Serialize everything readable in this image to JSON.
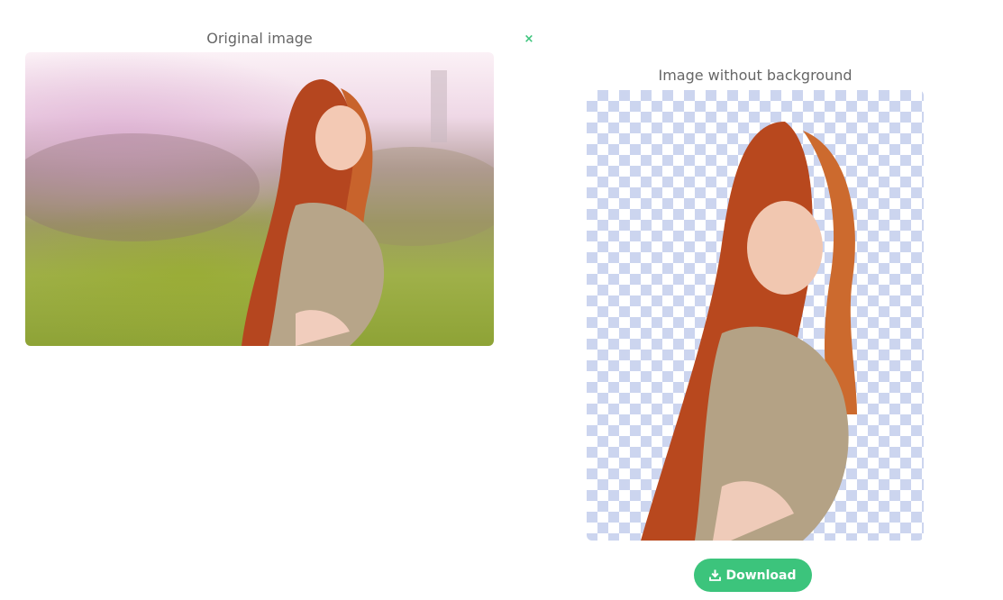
{
  "original": {
    "caption": "Original image"
  },
  "close": {
    "glyph": "×",
    "color": "#3cc47c"
  },
  "result": {
    "caption": "Image without background"
  },
  "download": {
    "label": "Download",
    "icon": "download-icon",
    "color": "#3cc47c"
  }
}
